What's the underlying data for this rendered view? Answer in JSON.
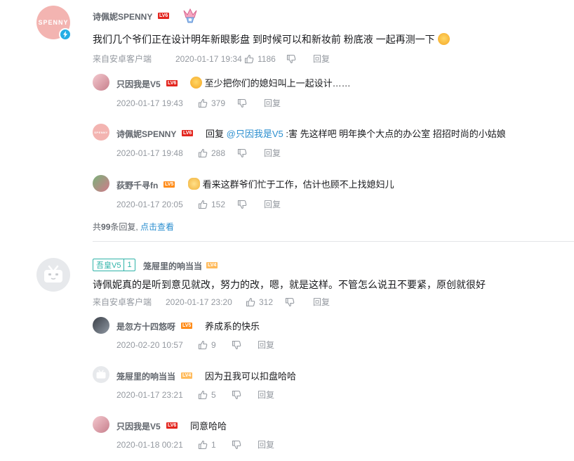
{
  "thread1": {
    "user": "诗佩妮SPENNY",
    "level": "LV6",
    "avatar_text": "SPENNY",
    "text": "我们几个爷们正在设计明年新眼影盘 到时候可以和新妆前 粉底液 一起再测一下",
    "source": "来自安卓客户端",
    "time": "2020-01-17 19:34",
    "likes": "1186",
    "reply_label": "回复",
    "replies": [
      {
        "user": "只因我是V5",
        "level": "LV6",
        "text": "至少把你们的媳妇叫上一起设计……",
        "time": "2020-01-17 19:43",
        "likes": "379",
        "reply_label": "回复"
      },
      {
        "user": "诗佩妮SPENNY",
        "level": "LV6",
        "reply_prefix": "回复 ",
        "mention": "@只因我是V5",
        "text": " :害 先这样吧 明年换个大点的办公室 招招时尚的小姑娘",
        "time": "2020-01-17 19:48",
        "likes": "288",
        "reply_label": "回复"
      },
      {
        "user": "荻野千寻fn",
        "level": "LV5",
        "text": "看来这群爷们忙于工作，估计也顾不上找媳妇儿",
        "time": "2020-01-17 20:05",
        "likes": "152",
        "reply_label": "回复"
      }
    ],
    "more_prefix": "共",
    "more_count": "99",
    "more_suffix": "条回复, ",
    "more_link": "点击查看"
  },
  "thread2": {
    "fan_badge_name": "吾皇V5",
    "fan_badge_level": "1",
    "user": "笼屉里的响当当",
    "level": "LV4",
    "text": "诗佩妮真的是听到意见就改，努力的改，嗯，就是这样。不管怎么说丑不要紧，原创就很好",
    "source": "来自安卓客户端",
    "time": "2020-01-17 23:20",
    "likes": "312",
    "reply_label": "回复",
    "replies": [
      {
        "user": "是忽方十四悠呀",
        "level": "LV5",
        "text": "养成系的快乐",
        "time": "2020-02-20 10:57",
        "likes": "9",
        "reply_label": "回复"
      },
      {
        "user": "笼屉里的响当当",
        "level": "LV4",
        "text": "因为丑我可以扣盘哈哈",
        "time": "2020-01-17 23:21",
        "likes": "5",
        "reply_label": "回复"
      },
      {
        "user": "只因我是V5",
        "level": "LV6",
        "text": "同意哈哈",
        "time": "2020-01-18 00:21",
        "likes": "1",
        "reply_label": "回复"
      }
    ]
  },
  "colors": {
    "level6": "#e3261f",
    "level5": "#ff8c1a",
    "level4": "#ffbb5c",
    "link": "#2a8ecf",
    "meta": "#9499a0",
    "fan_badge": "#2fb3a8"
  }
}
